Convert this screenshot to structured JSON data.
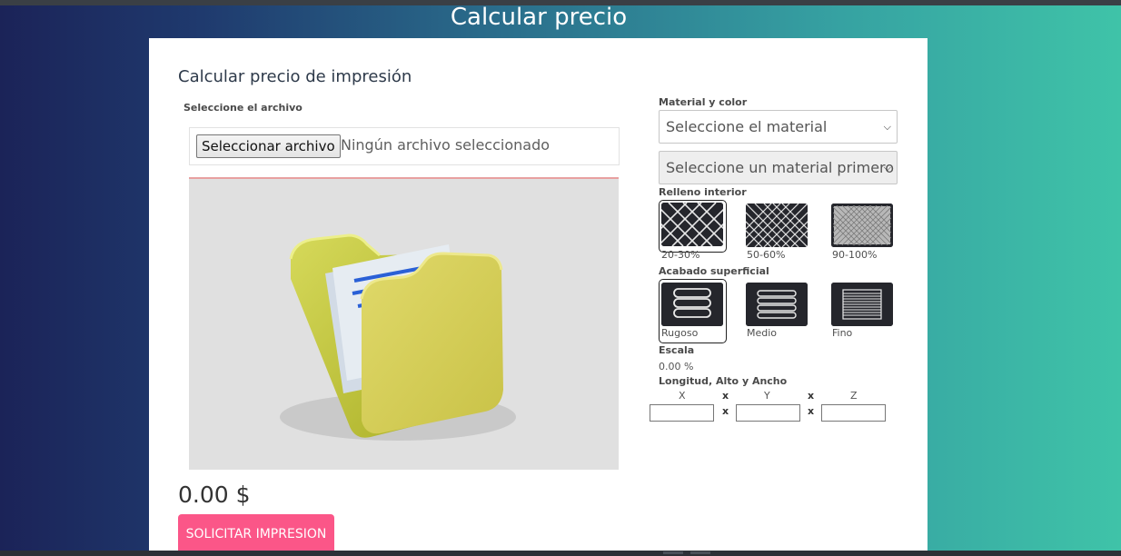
{
  "header": {
    "title": "Calcular precio"
  },
  "form": {
    "title": "Calcular precio de impresión",
    "file": {
      "label": "Seleccione el archivo",
      "button": "Seleccionar archivo",
      "status": "Ningún archivo seleccionado"
    },
    "viewer": {
      "icon": "folder-icon"
    },
    "price": "0.00 $",
    "submit": "SOLICITAR IMPRESION"
  },
  "options": {
    "material_label": "Material y color",
    "material_select": "Seleccione el material",
    "color_select": "Seleccione un material primero",
    "infill_label": "Relleno interior",
    "infill": [
      {
        "label": "20-30%",
        "selected": true
      },
      {
        "label": "50-60%",
        "selected": false
      },
      {
        "label": "90-100%",
        "selected": false
      }
    ],
    "finish_label": "Acabado superficial",
    "finish": [
      {
        "label": "Rugoso",
        "selected": true
      },
      {
        "label": "Medio",
        "selected": false
      },
      {
        "label": "Fino",
        "selected": false
      }
    ],
    "scale_label": "Escala",
    "scale_value": "0.00 %",
    "dimensions_label": "Longitud, Alto y Ancho",
    "dimensions": {
      "axes": [
        "X",
        "Y",
        "Z"
      ],
      "separator": "x",
      "values": [
        "",
        "",
        ""
      ]
    }
  },
  "colors": {
    "accent": "#fb5688",
    "card": "#ffffff",
    "swatch": "#25262c"
  }
}
